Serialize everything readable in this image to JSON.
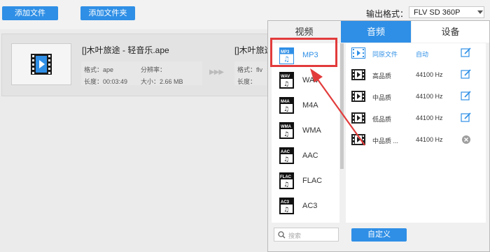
{
  "toolbar": {
    "add_file_label": "添加文件",
    "add_folder_label": "添加文件夹"
  },
  "output_format": {
    "label": "输出格式：",
    "value": "FLV  SD 360P"
  },
  "file": {
    "source_name": "[]木叶旅途 - 轻音乐.ape",
    "source_format_label": "格式：ape",
    "source_resolution_label": "分辨率：",
    "source_duration_label": "长度：00:03:49",
    "source_size_label": "大小：2.66 MB",
    "target_name": "[]木叶旅途",
    "target_format_label": "格式：flv",
    "target_duration_label": "长度："
  },
  "popup": {
    "tabs": [
      {
        "label": "视频"
      },
      {
        "label": "音频"
      },
      {
        "label": "设备"
      }
    ],
    "formats": [
      {
        "label": "MP3",
        "icon_text": "MP3"
      },
      {
        "label": "WAV",
        "icon_text": "WAV"
      },
      {
        "label": "M4A",
        "icon_text": "M4A"
      },
      {
        "label": "WMA",
        "icon_text": "WMA"
      },
      {
        "label": "AAC",
        "icon_text": "AAC"
      },
      {
        "label": "FLAC",
        "icon_text": "FLAC"
      },
      {
        "label": "AC3",
        "icon_text": "AC3"
      }
    ],
    "quality_rows": [
      {
        "name": "同原文件",
        "value": "自动"
      },
      {
        "name": "高品质",
        "value": "44100 Hz"
      },
      {
        "name": "中品质",
        "value": "44100 Hz"
      },
      {
        "name": "低品质",
        "value": "44100 Hz"
      },
      {
        "name": "中品质 ...",
        "value": "44100 Hz"
      }
    ],
    "search_placeholder": "搜索",
    "custom_button_label": "自定义"
  },
  "colors": {
    "accent": "#2f8fe6",
    "highlight_box": "#e23b3b"
  }
}
